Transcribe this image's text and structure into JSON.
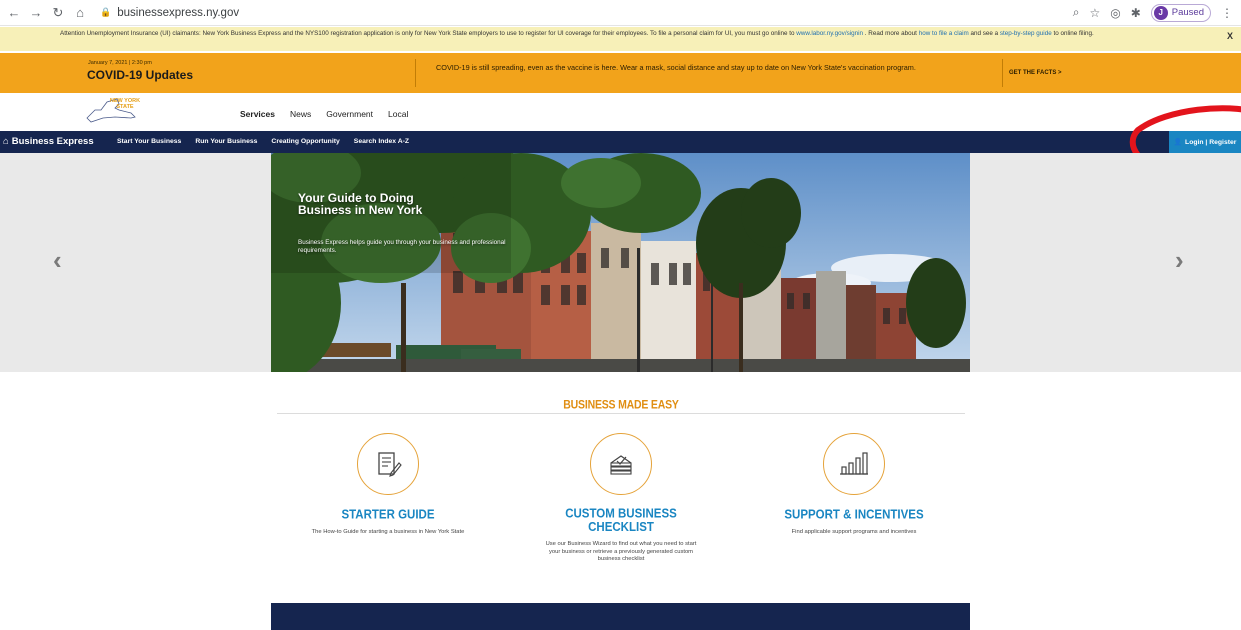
{
  "browser": {
    "url": "businessexpress.ny.gov",
    "profile_initial": "J",
    "profile_status": "Paused"
  },
  "alert": {
    "text_1": "Attention Unemployment Insurance (UI) claimants: New York Business Express and the NYS100 registration application is only for New York State employers to use to register for UI coverage for their employees. To file a personal claim for UI, you must go online to ",
    "link_1": "www.labor.ny.gov/signin",
    "text_2": " . Read more about ",
    "link_2": "how to file a claim",
    "text_3": " and see a ",
    "link_3": "step-by-step guide",
    "text_4": " to online filing.",
    "close": "X"
  },
  "covid": {
    "date": "January 7, 2021 | 2:30 pm",
    "title": "COVID-19 Updates",
    "message": "COVID-19 is still spreading, even as the vaccine is here. Wear a mask, social distance and stay up to date on New York State's vaccination program.",
    "cta": "GET THE FACTS  >"
  },
  "logo": {
    "text": "NEW YORK STATE"
  },
  "main_nav": [
    "Services",
    "News",
    "Government",
    "Local"
  ],
  "blue_nav": {
    "home": "Business Express",
    "items": [
      "Start Your Business",
      "Run Your Business",
      "Creating Opportunity",
      "Search Index A-Z"
    ],
    "login": "Login | Register"
  },
  "hero": {
    "title": "Your Guide to Doing Business in New York",
    "subtitle": "Business Express helps guide you through your business and professional requirements.",
    "prev": "‹",
    "next": "›"
  },
  "section": {
    "title": "BUSINESS MADE EASY",
    "cards": [
      {
        "title": "STARTER GUIDE",
        "desc": "The How-to Guide for starting a business in New York State"
      },
      {
        "title": "CUSTOM BUSINESS CHECKLIST",
        "desc": "Use our Business Wizard to find out what you need to start your business or retrieve a previously generated custom business checklist"
      },
      {
        "title": "SUPPORT & INCENTIVES",
        "desc": "Find applicable support programs and incentives"
      }
    ]
  },
  "colors": {
    "navy": "#15254f",
    "orange": "#f2a31b",
    "accent_blue": "#1a86c2",
    "alert_yellow": "#f7f0b8"
  }
}
